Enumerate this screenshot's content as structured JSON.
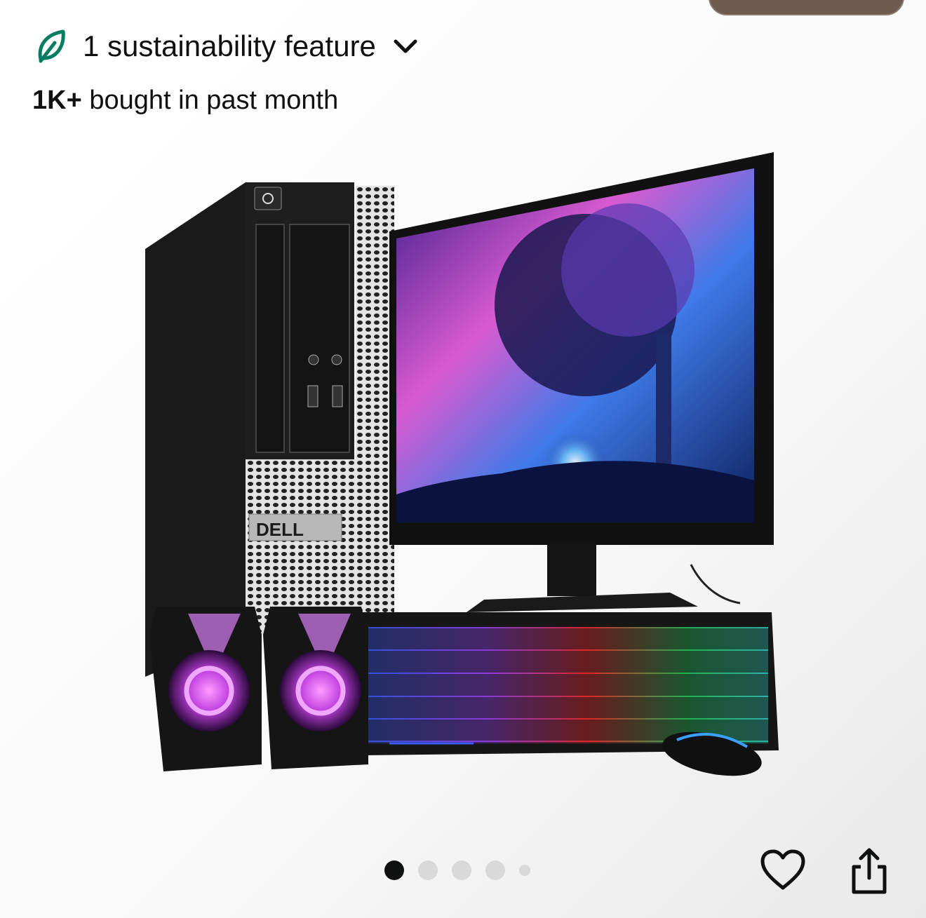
{
  "sustainability": {
    "label": "1 sustainability feature",
    "leaf_icon": "leaf-icon",
    "chevron_icon": "chevron-down-icon",
    "leaf_color": "#067d62"
  },
  "bought": {
    "count": "1K+",
    "text": " bought in past month"
  },
  "product_image": {
    "brand_badge": "DELL"
  },
  "carousel": {
    "slide_count": 5,
    "active_index": 0
  },
  "actions": {
    "favorite_icon": "heart-icon",
    "share_icon": "share-icon"
  }
}
